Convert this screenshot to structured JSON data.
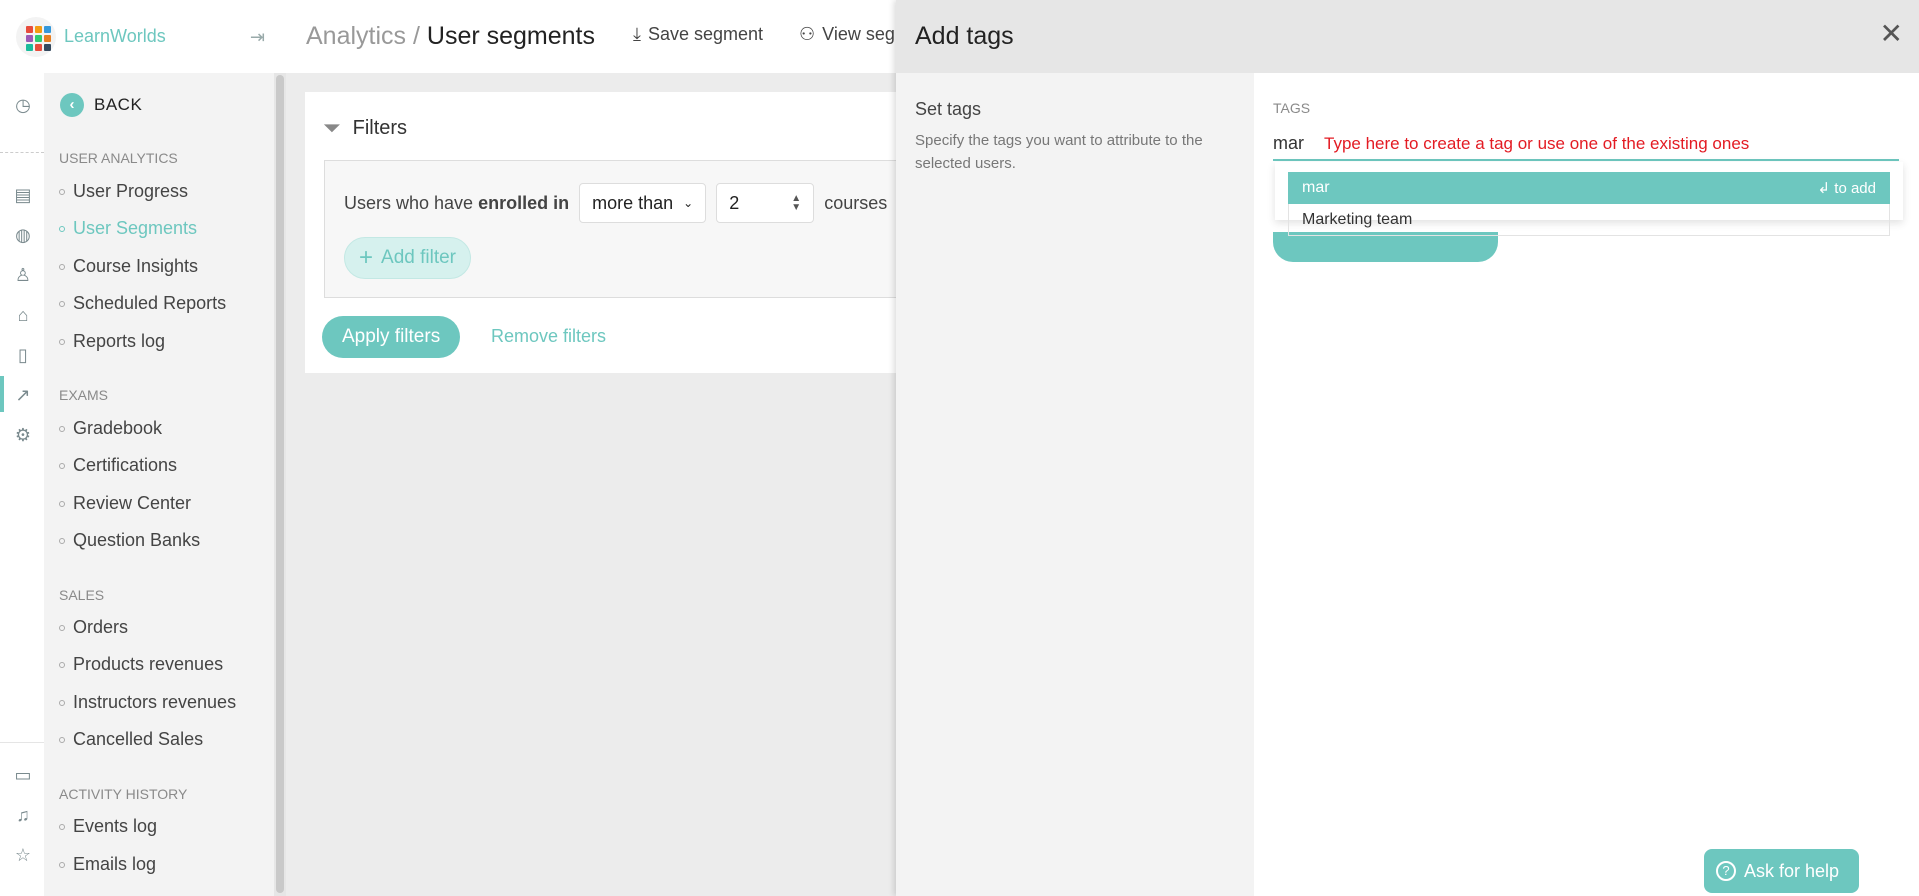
{
  "app": {
    "brand": "LearnWorlds"
  },
  "colors": {
    "accent": "#6dc7bf",
    "hint_red": "#e31b23"
  },
  "sidebar": {
    "back_label": "BACK",
    "sections": [
      {
        "title": "USER ANALYTICS",
        "items": [
          "User Progress",
          "User Segments",
          "Course Insights",
          "Scheduled Reports",
          "Reports log"
        ]
      },
      {
        "title": "EXAMS",
        "items": [
          "Gradebook",
          "Certifications",
          "Review Center",
          "Question Banks"
        ]
      },
      {
        "title": "SALES",
        "items": [
          "Orders",
          "Products revenues",
          "Instructors revenues",
          "Cancelled Sales"
        ]
      },
      {
        "title": "ACTIVITY HISTORY",
        "items": [
          "Events log",
          "Emails log"
        ]
      }
    ],
    "active_item": "User Segments"
  },
  "header": {
    "breadcrumb_parent": "Analytics",
    "breadcrumb_sep": " / ",
    "breadcrumb_current": "User segments",
    "save_segment": "Save segment",
    "view_segments": "View seg"
  },
  "filters": {
    "title": "Filters",
    "rule_prefix": "Users who have",
    "rule_bold": "enrolled in",
    "operator": "more than",
    "count": "2",
    "rule_suffix": "courses",
    "add_filter": "Add filter",
    "apply": "Apply filters",
    "remove": "Remove filters"
  },
  "panel": {
    "title": "Add tags",
    "left_title": "Set tags",
    "left_desc": "Specify the tags you want to attribute to the selected users.",
    "tags_label": "TAGS",
    "typed_value": "mar",
    "hint": "Type here to create a tag or use one of the existing ones",
    "dropdown": {
      "highlight_value": "mar",
      "highlight_hint": "↲ to add",
      "option": "Marketing team"
    }
  },
  "help": {
    "label": "Ask for help"
  }
}
